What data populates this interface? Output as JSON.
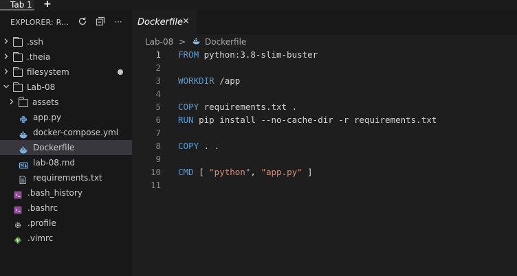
{
  "top_tab": {
    "label": "Tab 1",
    "add": "+"
  },
  "explorer": {
    "title": "EXPLORER: R...",
    "refresh_icon": "refresh-icon",
    "collapse_icon": "collapse-all-icon",
    "more_icon": "more-icon",
    "more_glyph": "···",
    "items": [
      {
        "label": ".ssh",
        "kind": "folder",
        "expanded": false
      },
      {
        "label": ".theia",
        "kind": "folder",
        "expanded": false
      },
      {
        "label": "filesystem",
        "kind": "folder",
        "expanded": false,
        "modified": true
      },
      {
        "label": "Lab-08",
        "kind": "folder",
        "expanded": true
      },
      {
        "label": "assets",
        "kind": "folder",
        "expanded": false
      },
      {
        "label": "app.py",
        "kind": "python-file"
      },
      {
        "label": "docker-compose.yml",
        "kind": "docker-file"
      },
      {
        "label": "Dockerfile",
        "kind": "docker-file",
        "selected": true
      },
      {
        "label": "lab-08.md",
        "kind": "markdown-file"
      },
      {
        "label": "requirements.txt",
        "kind": "text-file"
      },
      {
        "label": ".bash_history",
        "kind": "shell-file"
      },
      {
        "label": ".bashrc",
        "kind": "shell-file"
      },
      {
        "label": ".profile",
        "kind": "gear-file"
      },
      {
        "label": ".vimrc",
        "kind": "vim-file"
      }
    ]
  },
  "editor": {
    "tab_label": "Dockerfile",
    "close_glyph": "✕",
    "breadcrumb": {
      "folder": "Lab-08",
      "separator": ">",
      "file": "Dockerfile"
    },
    "lines": [
      {
        "n": "1",
        "kw": "FROM",
        "rest": " python:3.8-slim-buster"
      },
      {
        "n": "2",
        "kw": "",
        "rest": ""
      },
      {
        "n": "3",
        "kw": "WORKDIR",
        "rest": " /app"
      },
      {
        "n": "4",
        "kw": "",
        "rest": ""
      },
      {
        "n": "5",
        "kw": "COPY",
        "rest": " requirements.txt ."
      },
      {
        "n": "6",
        "kw": "RUN",
        "rest": " pip install --no-cache-dir -r requirements.txt"
      },
      {
        "n": "7",
        "kw": "",
        "rest": ""
      },
      {
        "n": "8",
        "kw": "COPY",
        "rest": " . ."
      },
      {
        "n": "9",
        "kw": "",
        "rest": ""
      },
      {
        "n": "10",
        "kw": "CMD",
        "rest": " [ ",
        "s1": "\"python\"",
        "mid": ", ",
        "s2": "\"app.py\"",
        "end": " ]"
      },
      {
        "n": "11",
        "kw": "",
        "rest": ""
      }
    ]
  },
  "colors": {
    "keyword": "#569cd6",
    "string": "#ce9178",
    "python_icon": "#5f9ad6",
    "docker_icon": "#7fb3e6",
    "markdown_icon": "#7fb3e6",
    "shell_icon": "#c678dd",
    "vim_icon": "#6aa84f"
  }
}
